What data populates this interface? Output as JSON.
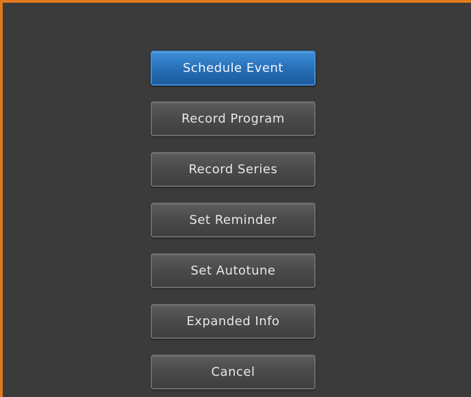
{
  "theme": {
    "frame_border": "#e07a1f",
    "panel_background": "#3b3b3b",
    "selected_accent": "#2870b8",
    "button_background": "#4b4b4b",
    "text_color": "#e8e8e8"
  },
  "menu": {
    "items": [
      {
        "label": "Schedule Event",
        "selected": true
      },
      {
        "label": "Record Program",
        "selected": false
      },
      {
        "label": "Record Series",
        "selected": false
      },
      {
        "label": "Set Reminder",
        "selected": false
      },
      {
        "label": "Set Autotune",
        "selected": false
      },
      {
        "label": "Expanded Info",
        "selected": false
      },
      {
        "label": "Cancel",
        "selected": false
      }
    ]
  }
}
